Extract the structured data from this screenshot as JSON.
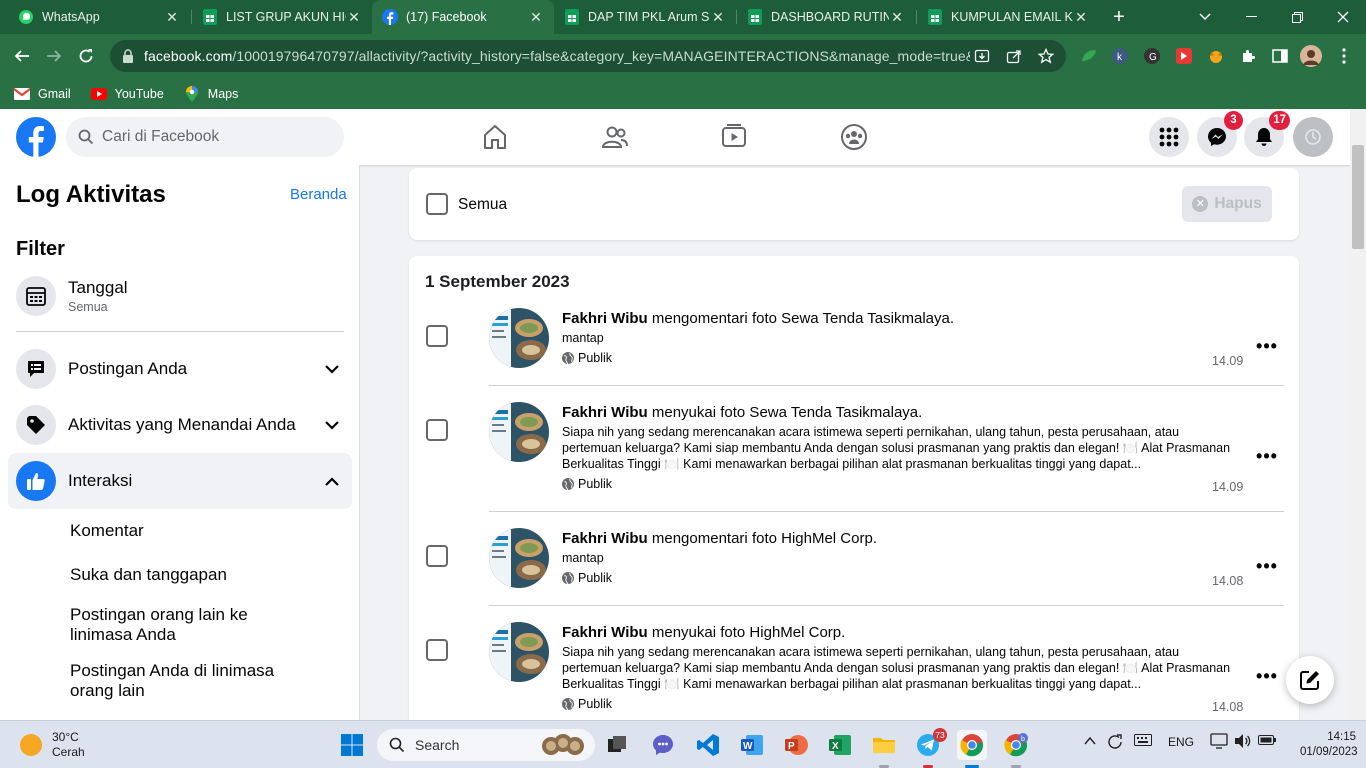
{
  "browser": {
    "tabs": [
      {
        "title": "WhatsApp",
        "icon": "whatsapp-icon",
        "active": false
      },
      {
        "title": "LIST GRUP AKUN HIGH",
        "icon": "sheets-icon",
        "active": false
      },
      {
        "title": "(17) Facebook",
        "icon": "facebook-icon",
        "active": true
      },
      {
        "title": "DAP TIM PKL Arum Sa",
        "icon": "sheets-icon",
        "active": false
      },
      {
        "title": "DASHBOARD RUTINIT",
        "icon": "sheets-icon",
        "active": false
      },
      {
        "title": "KUMPULAN EMAIL KU",
        "icon": "sheets-icon",
        "active": false
      }
    ],
    "url_host": "facebook.com",
    "url_path": "/100019796470797/allactivity/?activity_history=false&category_key=MANAGEINTERACTIONS&manage_mode=true&...",
    "bookmarks": [
      "Gmail",
      "YouTube",
      "Maps"
    ]
  },
  "facebook": {
    "search_placeholder": "Cari di Facebook",
    "messenger_badge": "3",
    "notifications_badge": "17"
  },
  "sidebar": {
    "title": "Log Aktivitas",
    "home_link": "Beranda",
    "filter_heading": "Filter",
    "date_filter": {
      "label": "Tanggal",
      "value": "Semua"
    },
    "sections": [
      {
        "label": "Postingan Anda"
      },
      {
        "label": "Aktivitas yang Menandai Anda"
      },
      {
        "label": "Interaksi"
      }
    ],
    "sub_items": [
      "Komentar",
      "Suka dan tanggapan",
      "Postingan orang lain ke linimasa Anda",
      "Postingan Anda di linimasa orang lain"
    ]
  },
  "main": {
    "select_all_label": "Semua",
    "delete_button": "Hapus",
    "date_heading": "1 September 2023",
    "entries": [
      {
        "actor": "Fakhri Wibu",
        "verb": "mengomentari",
        "object": "foto Sewa Tenda Tasikmalaya.",
        "body": "mantap",
        "privacy": "Publik",
        "time": "14.09"
      },
      {
        "actor": "Fakhri Wibu",
        "verb": "menyukai",
        "object": "foto Sewa Tenda Tasikmalaya.",
        "body": "Siapa nih yang sedang merencanakan acara istimewa seperti pernikahan, ulang tahun, pesta perusahaan, atau pertemuan keluarga? Kami siap membantu Anda dengan solusi prasmanan yang praktis dan elegan! 🍽️ Alat Prasmanan Berkualitas Tinggi 🍽️ Kami menawarkan berbagai pilihan alat prasmanan berkualitas tinggi yang dapat...",
        "privacy": "Publik",
        "time": "14.09"
      },
      {
        "actor": "Fakhri Wibu",
        "verb": "mengomentari",
        "object": "foto HighMel Corp.",
        "body": "mantap",
        "privacy": "Publik",
        "time": "14.08"
      },
      {
        "actor": "Fakhri Wibu",
        "verb": "menyukai",
        "object": "foto HighMel Corp.",
        "body": "Siapa nih yang sedang merencanakan acara istimewa seperti pernikahan, ulang tahun, pesta perusahaan, atau pertemuan keluarga? Kami siap membantu Anda dengan solusi prasmanan yang praktis dan elegan! 🍽️ Alat Prasmanan Berkualitas Tinggi 🍽️ Kami menawarkan berbagai pilihan alat prasmanan berkualitas tinggi yang dapat...",
        "privacy": "Publik",
        "time": "14.08"
      }
    ]
  },
  "taskbar": {
    "weather_temp": "30°C",
    "weather_desc": "Cerah",
    "search_label": "Search",
    "language": "ENG",
    "telegram_badge": "73",
    "time": "14:15",
    "date": "01/09/2023"
  },
  "colors": {
    "chrome_frame": "#1e5d3a",
    "chrome_toolbar": "#2a7045",
    "facebook_blue": "#1877f2",
    "badge_red": "#e41e3f"
  }
}
